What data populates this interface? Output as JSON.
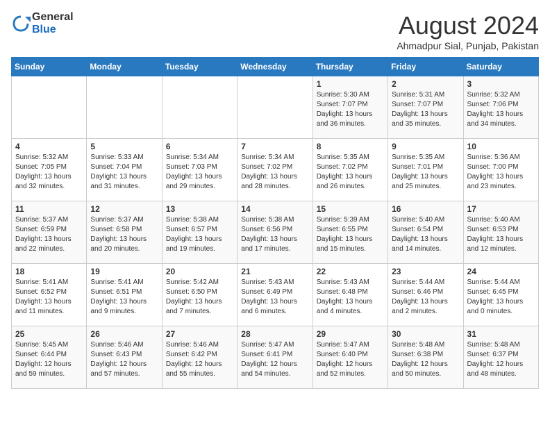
{
  "header": {
    "logo_general": "General",
    "logo_blue": "Blue",
    "month_title": "August 2024",
    "subtitle": "Ahmadpur Sial, Punjab, Pakistan"
  },
  "days_of_week": [
    "Sunday",
    "Monday",
    "Tuesday",
    "Wednesday",
    "Thursday",
    "Friday",
    "Saturday"
  ],
  "weeks": [
    [
      {
        "day": "",
        "info": ""
      },
      {
        "day": "",
        "info": ""
      },
      {
        "day": "",
        "info": ""
      },
      {
        "day": "",
        "info": ""
      },
      {
        "day": "1",
        "info": "Sunrise: 5:30 AM\nSunset: 7:07 PM\nDaylight: 13 hours\nand 36 minutes."
      },
      {
        "day": "2",
        "info": "Sunrise: 5:31 AM\nSunset: 7:07 PM\nDaylight: 13 hours\nand 35 minutes."
      },
      {
        "day": "3",
        "info": "Sunrise: 5:32 AM\nSunset: 7:06 PM\nDaylight: 13 hours\nand 34 minutes."
      }
    ],
    [
      {
        "day": "4",
        "info": "Sunrise: 5:32 AM\nSunset: 7:05 PM\nDaylight: 13 hours\nand 32 minutes."
      },
      {
        "day": "5",
        "info": "Sunrise: 5:33 AM\nSunset: 7:04 PM\nDaylight: 13 hours\nand 31 minutes."
      },
      {
        "day": "6",
        "info": "Sunrise: 5:34 AM\nSunset: 7:03 PM\nDaylight: 13 hours\nand 29 minutes."
      },
      {
        "day": "7",
        "info": "Sunrise: 5:34 AM\nSunset: 7:02 PM\nDaylight: 13 hours\nand 28 minutes."
      },
      {
        "day": "8",
        "info": "Sunrise: 5:35 AM\nSunset: 7:02 PM\nDaylight: 13 hours\nand 26 minutes."
      },
      {
        "day": "9",
        "info": "Sunrise: 5:35 AM\nSunset: 7:01 PM\nDaylight: 13 hours\nand 25 minutes."
      },
      {
        "day": "10",
        "info": "Sunrise: 5:36 AM\nSunset: 7:00 PM\nDaylight: 13 hours\nand 23 minutes."
      }
    ],
    [
      {
        "day": "11",
        "info": "Sunrise: 5:37 AM\nSunset: 6:59 PM\nDaylight: 13 hours\nand 22 minutes."
      },
      {
        "day": "12",
        "info": "Sunrise: 5:37 AM\nSunset: 6:58 PM\nDaylight: 13 hours\nand 20 minutes."
      },
      {
        "day": "13",
        "info": "Sunrise: 5:38 AM\nSunset: 6:57 PM\nDaylight: 13 hours\nand 19 minutes."
      },
      {
        "day": "14",
        "info": "Sunrise: 5:38 AM\nSunset: 6:56 PM\nDaylight: 13 hours\nand 17 minutes."
      },
      {
        "day": "15",
        "info": "Sunrise: 5:39 AM\nSunset: 6:55 PM\nDaylight: 13 hours\nand 15 minutes."
      },
      {
        "day": "16",
        "info": "Sunrise: 5:40 AM\nSunset: 6:54 PM\nDaylight: 13 hours\nand 14 minutes."
      },
      {
        "day": "17",
        "info": "Sunrise: 5:40 AM\nSunset: 6:53 PM\nDaylight: 13 hours\nand 12 minutes."
      }
    ],
    [
      {
        "day": "18",
        "info": "Sunrise: 5:41 AM\nSunset: 6:52 PM\nDaylight: 13 hours\nand 11 minutes."
      },
      {
        "day": "19",
        "info": "Sunrise: 5:41 AM\nSunset: 6:51 PM\nDaylight: 13 hours\nand 9 minutes."
      },
      {
        "day": "20",
        "info": "Sunrise: 5:42 AM\nSunset: 6:50 PM\nDaylight: 13 hours\nand 7 minutes."
      },
      {
        "day": "21",
        "info": "Sunrise: 5:43 AM\nSunset: 6:49 PM\nDaylight: 13 hours\nand 6 minutes."
      },
      {
        "day": "22",
        "info": "Sunrise: 5:43 AM\nSunset: 6:48 PM\nDaylight: 13 hours\nand 4 minutes."
      },
      {
        "day": "23",
        "info": "Sunrise: 5:44 AM\nSunset: 6:46 PM\nDaylight: 13 hours\nand 2 minutes."
      },
      {
        "day": "24",
        "info": "Sunrise: 5:44 AM\nSunset: 6:45 PM\nDaylight: 13 hours\nand 0 minutes."
      }
    ],
    [
      {
        "day": "25",
        "info": "Sunrise: 5:45 AM\nSunset: 6:44 PM\nDaylight: 12 hours\nand 59 minutes."
      },
      {
        "day": "26",
        "info": "Sunrise: 5:46 AM\nSunset: 6:43 PM\nDaylight: 12 hours\nand 57 minutes."
      },
      {
        "day": "27",
        "info": "Sunrise: 5:46 AM\nSunset: 6:42 PM\nDaylight: 12 hours\nand 55 minutes."
      },
      {
        "day": "28",
        "info": "Sunrise: 5:47 AM\nSunset: 6:41 PM\nDaylight: 12 hours\nand 54 minutes."
      },
      {
        "day": "29",
        "info": "Sunrise: 5:47 AM\nSunset: 6:40 PM\nDaylight: 12 hours\nand 52 minutes."
      },
      {
        "day": "30",
        "info": "Sunrise: 5:48 AM\nSunset: 6:38 PM\nDaylight: 12 hours\nand 50 minutes."
      },
      {
        "day": "31",
        "info": "Sunrise: 5:48 AM\nSunset: 6:37 PM\nDaylight: 12 hours\nand 48 minutes."
      }
    ]
  ]
}
